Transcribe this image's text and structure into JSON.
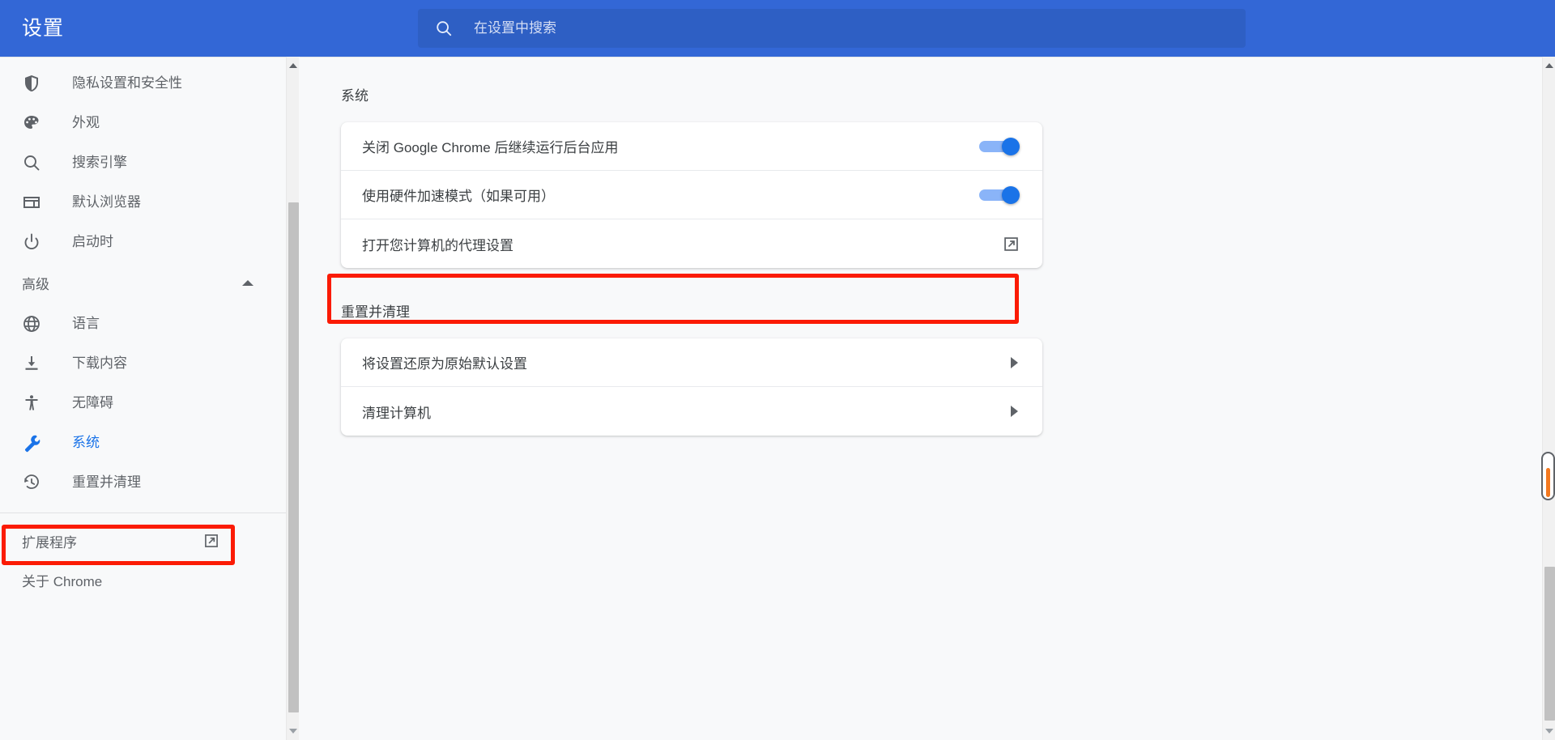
{
  "app": {
    "title": "设置"
  },
  "search": {
    "placeholder": "在设置中搜索",
    "value": "",
    "icon": "search-icon"
  },
  "sidebar": {
    "items": [
      {
        "label": "隐私设置和安全性",
        "icon": "shield-icon",
        "selected": false
      },
      {
        "label": "外观",
        "icon": "palette-icon",
        "selected": false
      },
      {
        "label": "搜索引擎",
        "icon": "search-icon",
        "selected": false
      },
      {
        "label": "默认浏览器",
        "icon": "browser-window-icon",
        "selected": false
      },
      {
        "label": "启动时",
        "icon": "power-icon",
        "selected": false
      }
    ],
    "advanced": {
      "label": "高级",
      "expanded": true,
      "chevron_icon": "chevron-up-icon",
      "items": [
        {
          "label": "语言",
          "icon": "globe-icon",
          "selected": false
        },
        {
          "label": "下载内容",
          "icon": "download-icon",
          "selected": false
        },
        {
          "label": "无障碍",
          "icon": "accessibility-icon",
          "selected": false
        },
        {
          "label": "系统",
          "icon": "wrench-icon",
          "selected": true
        },
        {
          "label": "重置并清理",
          "icon": "restore-history-icon",
          "selected": false
        }
      ]
    },
    "footer": [
      {
        "label": "扩展程序",
        "icon": "external-link-icon",
        "has_external": true
      },
      {
        "label": "关于 Chrome",
        "has_external": false
      }
    ]
  },
  "main": {
    "sections": [
      {
        "title": "系统",
        "rows": [
          {
            "label": "关闭 Google Chrome 后继续运行后台应用",
            "control": "toggle",
            "toggle_on": true
          },
          {
            "label": "使用硬件加速模式（如果可用）",
            "control": "toggle",
            "toggle_on": true
          },
          {
            "label": "打开您计算机的代理设置",
            "control": "external-link",
            "highlighted": true
          }
        ]
      },
      {
        "title": "重置并清理",
        "rows": [
          {
            "label": "将设置还原为原始默认设置",
            "control": "arrow"
          },
          {
            "label": "清理计算机",
            "control": "arrow"
          }
        ]
      }
    ]
  },
  "annotations": [
    {
      "name": "sidebar-system-highlight",
      "color": "#fb1b05"
    },
    {
      "name": "proxy-settings-row-highlight",
      "color": "#fb1b05"
    }
  ],
  "colors": {
    "topbar": "#3367d6",
    "search_field": "#2e5fc4",
    "accent": "#1a73e8",
    "toggle_track": "#8ab4f8",
    "page_bg": "#f8f9fa",
    "card_bg": "#ffffff",
    "text_primary": "#3c4043",
    "text_secondary": "#5f6368",
    "annotation": "#fb1b05",
    "scroll_marker": "#f4791f"
  },
  "scrollbars": {
    "sidebar": {
      "up_arrow": "▲",
      "down_arrow": "▼"
    },
    "page": {
      "up_arrow": "▲",
      "down_arrow": "▼"
    }
  }
}
